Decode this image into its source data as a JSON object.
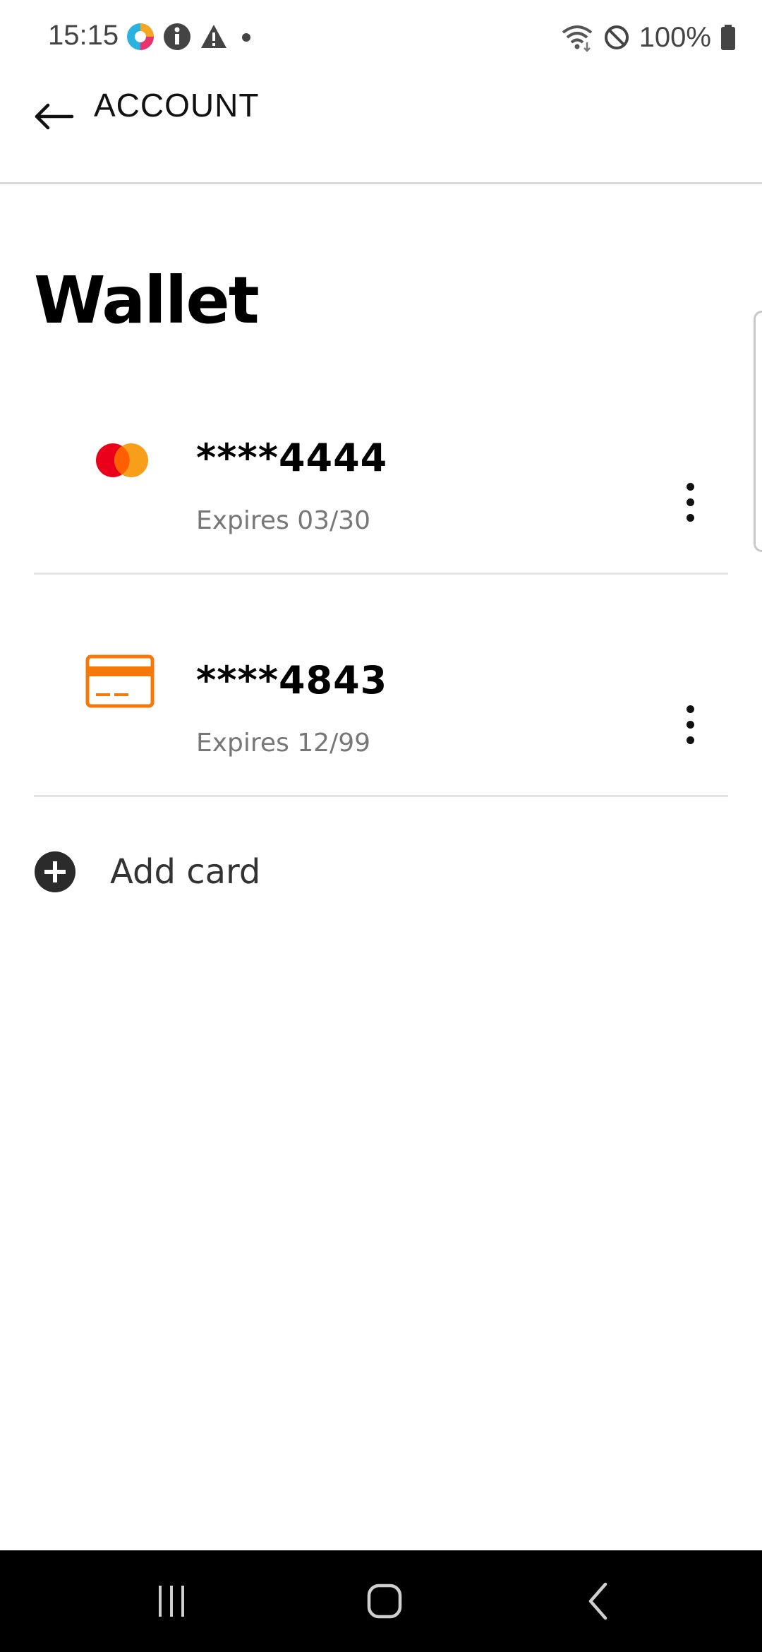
{
  "status_bar": {
    "time": "15:15",
    "battery": "100%",
    "icons_left": [
      "app-notification-icon",
      "info-icon",
      "warning-icon",
      "dot-icon"
    ],
    "icons_right": [
      "wifi-icon",
      "do-not-disturb-icon",
      "battery-icon"
    ]
  },
  "header": {
    "back_icon": "arrow-left-icon",
    "title": "ACCOUNT"
  },
  "page": {
    "title": "Wallet"
  },
  "cards": [
    {
      "brand_icon": "mastercard-icon",
      "number": "****4444",
      "expiry": "Expires 03/30"
    },
    {
      "brand_icon": "generic-card-icon",
      "number": "****4843",
      "expiry": "Expires 12/99"
    }
  ],
  "add_card": {
    "label": "Add card",
    "icon": "plus-circle-icon"
  },
  "colors": {
    "accent": "#f5780a",
    "mastercard_red": "#eb001b",
    "mastercard_orange": "#f79e1b"
  },
  "nav_bar": [
    "recents-icon",
    "home-icon",
    "back-icon"
  ]
}
